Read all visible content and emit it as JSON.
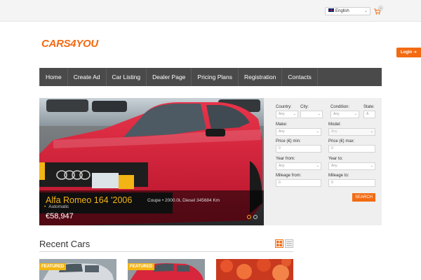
{
  "topbar": {
    "language": "English",
    "cart_count": "0"
  },
  "brand": {
    "logo_text": "CARS4YOU"
  },
  "login": {
    "label": "Login"
  },
  "nav": {
    "items": [
      "Home",
      "Create Ad",
      "Car Listing",
      "Dealer Page",
      "Pricing Plans",
      "Registration",
      "Contacts"
    ]
  },
  "slider": {
    "title": "Alfa Romeo 164 '2006",
    "meta": "Coupe  •  2000.0L Diesel 345684 Km",
    "transmission": "Automatic",
    "price": "€58,947",
    "active_slide": 1,
    "slide_count": 2
  },
  "search": {
    "country": {
      "label": "Country:",
      "value": "Any"
    },
    "city": {
      "label": "City:",
      "value": ""
    },
    "condition": {
      "label": "Condition:",
      "value": "Any"
    },
    "state": {
      "label": "State:",
      "value": "A"
    },
    "make": {
      "label": "Make:",
      "value": "Any"
    },
    "model": {
      "label": "Model:",
      "value": "Any"
    },
    "price_min": {
      "label": "Price (€) min:",
      "value": "0"
    },
    "price_max": {
      "label": "Price (€) max:",
      "value": "0"
    },
    "year_from": {
      "label": "Year from:",
      "value": "Any"
    },
    "year_to": {
      "label": "Year to:",
      "value": "Any"
    },
    "mileage_from": {
      "label": "Mileage from:",
      "value": "0"
    },
    "mileage_to": {
      "label": "Mileage to:",
      "value": "0"
    },
    "button": "SEARCH"
  },
  "recent": {
    "title": "Recent Cars",
    "cards": [
      {
        "badge": "FEATURED"
      },
      {
        "badge": "FEATURED"
      },
      {
        "badge": ""
      }
    ]
  },
  "colors": {
    "accent": "#f36a11",
    "highlight": "#f3b515",
    "nav_bg": "#4a4a4a",
    "panel_bg": "#efefef"
  },
  "icons": [
    "uk-flag-icon",
    "cart-icon",
    "login-arrow-icon",
    "grid-view-icon",
    "list-view-icon"
  ]
}
